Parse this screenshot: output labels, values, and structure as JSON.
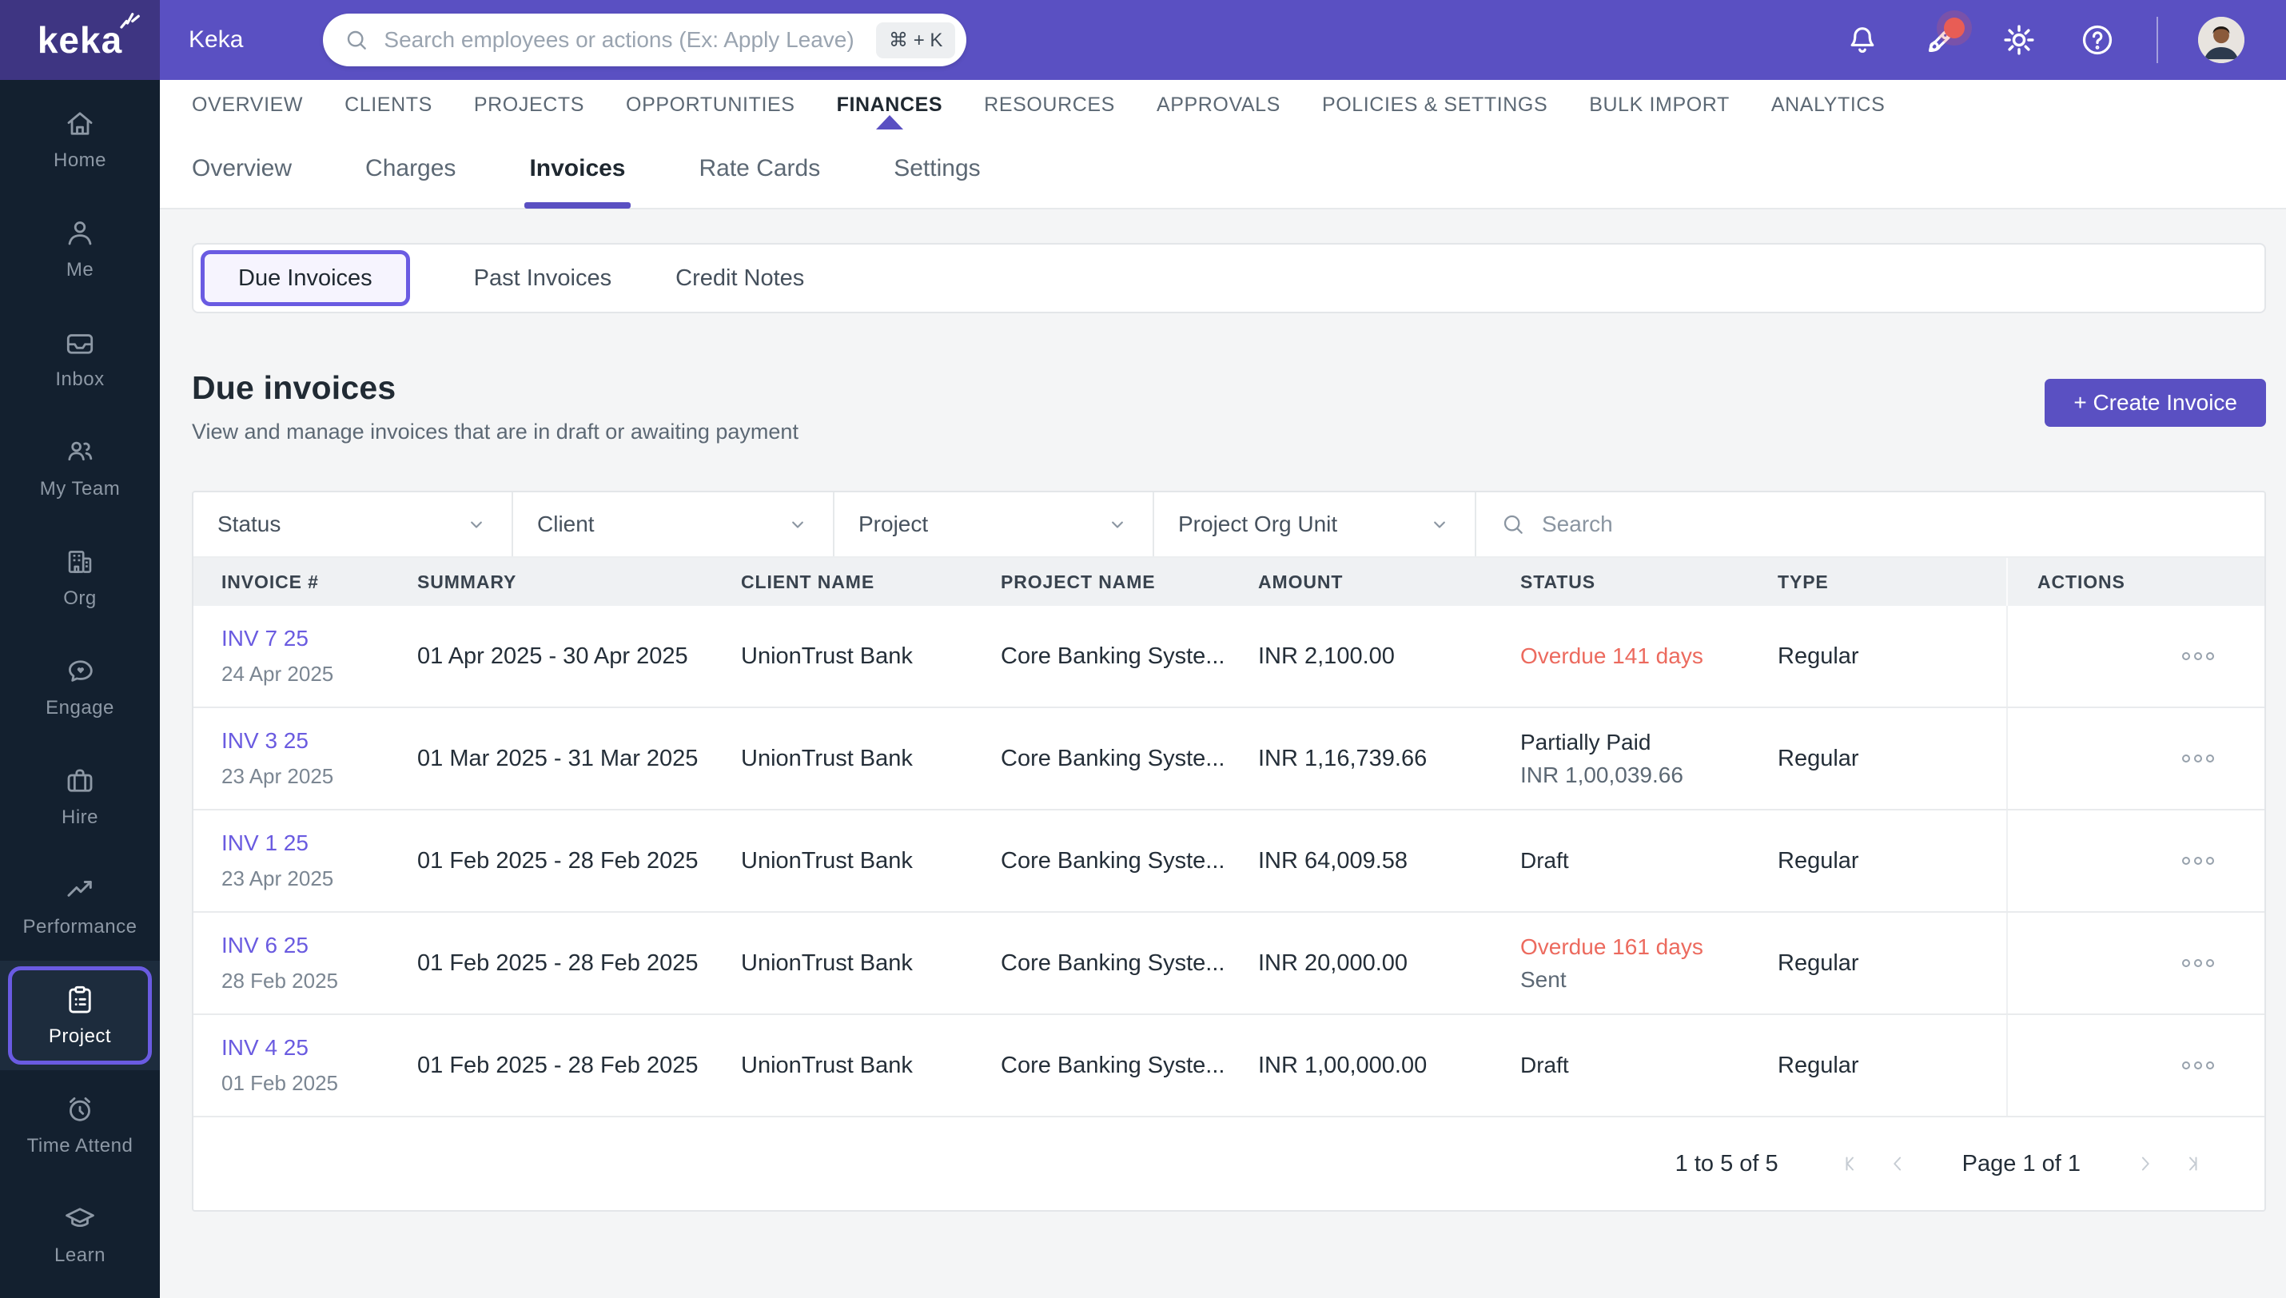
{
  "topbar": {
    "logo_text": "keka",
    "app_title": "Keka",
    "search_placeholder": "Search employees or actions (Ex: Apply Leave)",
    "search_shortcut": "⌘ + K",
    "icons": [
      "bell-icon",
      "rocket-icon",
      "gear-icon",
      "help-icon",
      "avatar"
    ]
  },
  "sidebar": {
    "items": [
      {
        "label": "Home",
        "icon": "home-icon",
        "active": false
      },
      {
        "label": "Me",
        "icon": "person-icon",
        "active": false
      },
      {
        "label": "Inbox",
        "icon": "inbox-icon",
        "active": false
      },
      {
        "label": "My Team",
        "icon": "team-icon",
        "active": false
      },
      {
        "label": "Org",
        "icon": "building-icon",
        "active": false
      },
      {
        "label": "Engage",
        "icon": "chat-heart-icon",
        "active": false
      },
      {
        "label": "Hire",
        "icon": "briefcase-icon",
        "active": false
      },
      {
        "label": "Performance",
        "icon": "trend-icon",
        "active": false
      },
      {
        "label": "Project",
        "icon": "clipboard-icon",
        "active": true
      },
      {
        "label": "Time Attend",
        "icon": "alarm-icon",
        "active": false
      },
      {
        "label": "Learn",
        "icon": "graduation-icon",
        "active": false
      }
    ]
  },
  "topnav": {
    "items": [
      {
        "label": "OVERVIEW",
        "active": false
      },
      {
        "label": "CLIENTS",
        "active": false
      },
      {
        "label": "PROJECTS",
        "active": false
      },
      {
        "label": "OPPORTUNITIES",
        "active": false
      },
      {
        "label": "FINANCES",
        "active": true
      },
      {
        "label": "RESOURCES",
        "active": false
      },
      {
        "label": "APPROVALS",
        "active": false
      },
      {
        "label": "POLICIES & SETTINGS",
        "active": false
      },
      {
        "label": "BULK IMPORT",
        "active": false
      },
      {
        "label": "ANALYTICS",
        "active": false
      }
    ]
  },
  "subnav": {
    "items": [
      {
        "label": "Overview",
        "active": false
      },
      {
        "label": "Charges",
        "active": false
      },
      {
        "label": "Invoices",
        "active": true
      },
      {
        "label": "Rate Cards",
        "active": false
      },
      {
        "label": "Settings",
        "active": false
      }
    ]
  },
  "tabs": {
    "items": [
      {
        "label": "Due Invoices",
        "active": true
      },
      {
        "label": "Past Invoices",
        "active": false
      },
      {
        "label": "Credit Notes",
        "active": false
      }
    ]
  },
  "page": {
    "title": "Due invoices",
    "subtitle": "View and manage invoices that are in draft or awaiting payment",
    "create_button": "+ Create Invoice"
  },
  "filters": {
    "status": "Status",
    "client": "Client",
    "project": "Project",
    "org_unit": "Project Org Unit",
    "search_placeholder": "Search"
  },
  "table": {
    "headers": [
      "INVOICE #",
      "SUMMARY",
      "CLIENT NAME",
      "PROJECT NAME",
      "AMOUNT",
      "STATUS",
      "TYPE",
      "ACTIONS"
    ],
    "rows": [
      {
        "invoice_no": "INV 7 25",
        "invoice_date": "24 Apr 2025",
        "summary": "01 Apr 2025 - 30 Apr 2025",
        "client": "UnionTrust Bank",
        "project": "Core Banking Syste...",
        "amount": "INR 2,100.00",
        "status": "Overdue 141 days",
        "status_sub": "",
        "status_color": "red",
        "type": "Regular"
      },
      {
        "invoice_no": "INV 3 25",
        "invoice_date": "23 Apr 2025",
        "summary": "01 Mar 2025 - 31 Mar 2025",
        "client": "UnionTrust Bank",
        "project": "Core Banking Syste...",
        "amount": "INR 1,16,739.66",
        "status": "Partially Paid",
        "status_sub": "INR 1,00,039.66",
        "status_color": "dark",
        "type": "Regular"
      },
      {
        "invoice_no": "INV 1 25",
        "invoice_date": "23 Apr 2025",
        "summary": "01 Feb 2025 - 28 Feb 2025",
        "client": "UnionTrust Bank",
        "project": "Core Banking Syste...",
        "amount": "INR 64,009.58",
        "status": "Draft",
        "status_sub": "",
        "status_color": "dark",
        "type": "Regular"
      },
      {
        "invoice_no": "INV 6 25",
        "invoice_date": "28 Feb 2025",
        "summary": "01 Feb 2025 - 28 Feb 2025",
        "client": "UnionTrust Bank",
        "project": "Core Banking Syste...",
        "amount": "INR 20,000.00",
        "status": "Overdue 161 days",
        "status_sub": "Sent",
        "status_color": "red",
        "type": "Regular"
      },
      {
        "invoice_no": "INV 4 25",
        "invoice_date": "01 Feb 2025",
        "summary": "01 Feb 2025 - 28 Feb 2025",
        "client": "UnionTrust Bank",
        "project": "Core Banking Syste...",
        "amount": "INR 1,00,000.00",
        "status": "Draft",
        "status_sub": "",
        "status_color": "dark",
        "type": "Regular"
      }
    ]
  },
  "pagination": {
    "range": "1 to 5 of 5",
    "page": "Page 1 of 1"
  },
  "colors": {
    "accent_purple": "#5a50c2",
    "link_purple": "#6a5be0",
    "logo_purple": "#3e3582",
    "sidebar_navy": "#13202f",
    "status_red": "#ec6a5e",
    "page_bg": "#f4f5f6"
  }
}
